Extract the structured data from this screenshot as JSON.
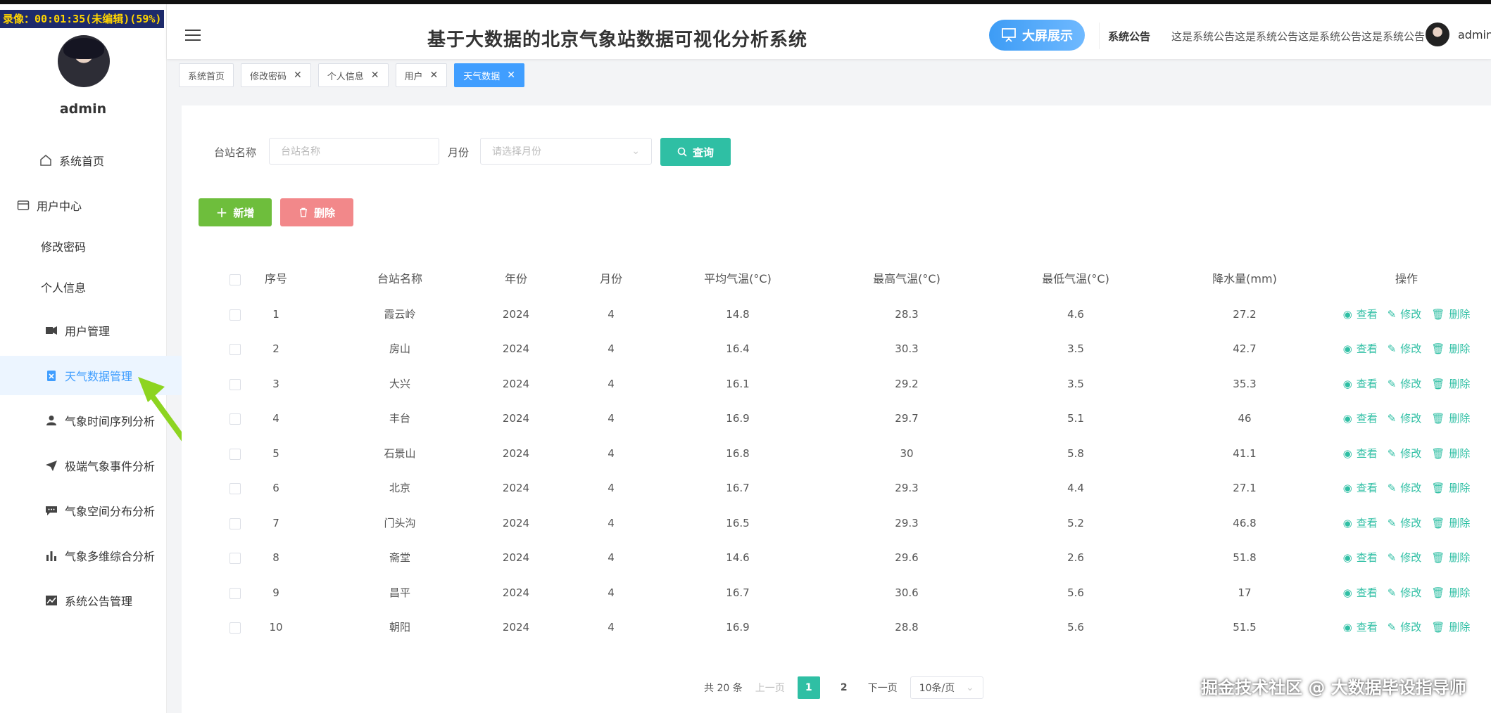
{
  "recording": {
    "text": "录像：00:01:35(未编辑)(59%)"
  },
  "sidebar": {
    "username": "admin",
    "items": [
      {
        "label": "系统首页",
        "icon": "home-icon"
      },
      {
        "label": "用户中心",
        "icon": "user-center-icon"
      },
      {
        "label": "修改密码"
      },
      {
        "label": "个人信息"
      },
      {
        "label": "用户管理",
        "icon": "users-icon"
      },
      {
        "label": "天气数据管理",
        "icon": "clipboard-icon"
      },
      {
        "label": "气象时间序列分析",
        "icon": "person-icon"
      },
      {
        "label": "极端气象事件分析",
        "icon": "paper-plane-icon"
      },
      {
        "label": "气象空间分布分析",
        "icon": "chat-icon"
      },
      {
        "label": "气象多维综合分析",
        "icon": "bar-chart-icon"
      },
      {
        "label": "系统公告管理",
        "icon": "line-chart-icon"
      }
    ]
  },
  "header": {
    "title": "基于大数据的北京气象站数据可视化分析系统",
    "bigscreen_label": "大屏展示",
    "notice_label": "系统公告",
    "notice_text": "这是系统公告这是系统公告这是系统公告这是系统公告",
    "username": "admin"
  },
  "tabs": [
    {
      "label": "系统首页",
      "closable": false,
      "active": false
    },
    {
      "label": "修改密码",
      "closable": true,
      "active": false
    },
    {
      "label": "个人信息",
      "closable": true,
      "active": false
    },
    {
      "label": "用户",
      "closable": true,
      "active": false
    },
    {
      "label": "天气数据",
      "closable": true,
      "active": true
    }
  ],
  "filters": {
    "station_label": "台站名称",
    "station_placeholder": "台站名称",
    "month_label": "月份",
    "month_placeholder": "请选择月份",
    "search_label": "查询"
  },
  "actions": {
    "add_label": "新增",
    "delete_label": "删除"
  },
  "table": {
    "headers": [
      "序号",
      "台站名称",
      "年份",
      "月份",
      "平均气温(°C)",
      "最高气温(°C)",
      "最低气温(°C)",
      "降水量(mm)",
      "操作"
    ],
    "op_labels": {
      "view": "查看",
      "edit": "修改",
      "delete": "删除"
    },
    "rows": [
      [
        "1",
        "霞云岭",
        "2024",
        "4",
        "14.8",
        "28.3",
        "4.6",
        "27.2"
      ],
      [
        "2",
        "房山",
        "2024",
        "4",
        "16.4",
        "30.3",
        "3.5",
        "42.7"
      ],
      [
        "3",
        "大兴",
        "2024",
        "4",
        "16.1",
        "29.2",
        "3.5",
        "35.3"
      ],
      [
        "4",
        "丰台",
        "2024",
        "4",
        "16.9",
        "29.7",
        "5.1",
        "46"
      ],
      [
        "5",
        "石景山",
        "2024",
        "4",
        "16.8",
        "30",
        "5.8",
        "41.1"
      ],
      [
        "6",
        "北京",
        "2024",
        "4",
        "16.7",
        "29.3",
        "4.4",
        "27.1"
      ],
      [
        "7",
        "门头沟",
        "2024",
        "4",
        "16.5",
        "29.3",
        "5.2",
        "46.8"
      ],
      [
        "8",
        "斋堂",
        "2024",
        "4",
        "14.6",
        "29.6",
        "2.6",
        "51.8"
      ],
      [
        "9",
        "昌平",
        "2024",
        "4",
        "16.7",
        "30.6",
        "5.6",
        "17"
      ],
      [
        "10",
        "朝阳",
        "2024",
        "4",
        "16.9",
        "28.8",
        "5.6",
        "51.5"
      ]
    ]
  },
  "pagination": {
    "total": "共 20 条",
    "prev": "上一页",
    "pages": [
      "1",
      "2"
    ],
    "current": "1",
    "next": "下一页",
    "page_size": "10条/页"
  },
  "watermark": "掘金技术社区 @ 大数据毕设指导师",
  "colors": {
    "accent": "#409eff",
    "teal": "#2fbfa4",
    "green": "#6ebe3c",
    "red": "#f2888a"
  }
}
